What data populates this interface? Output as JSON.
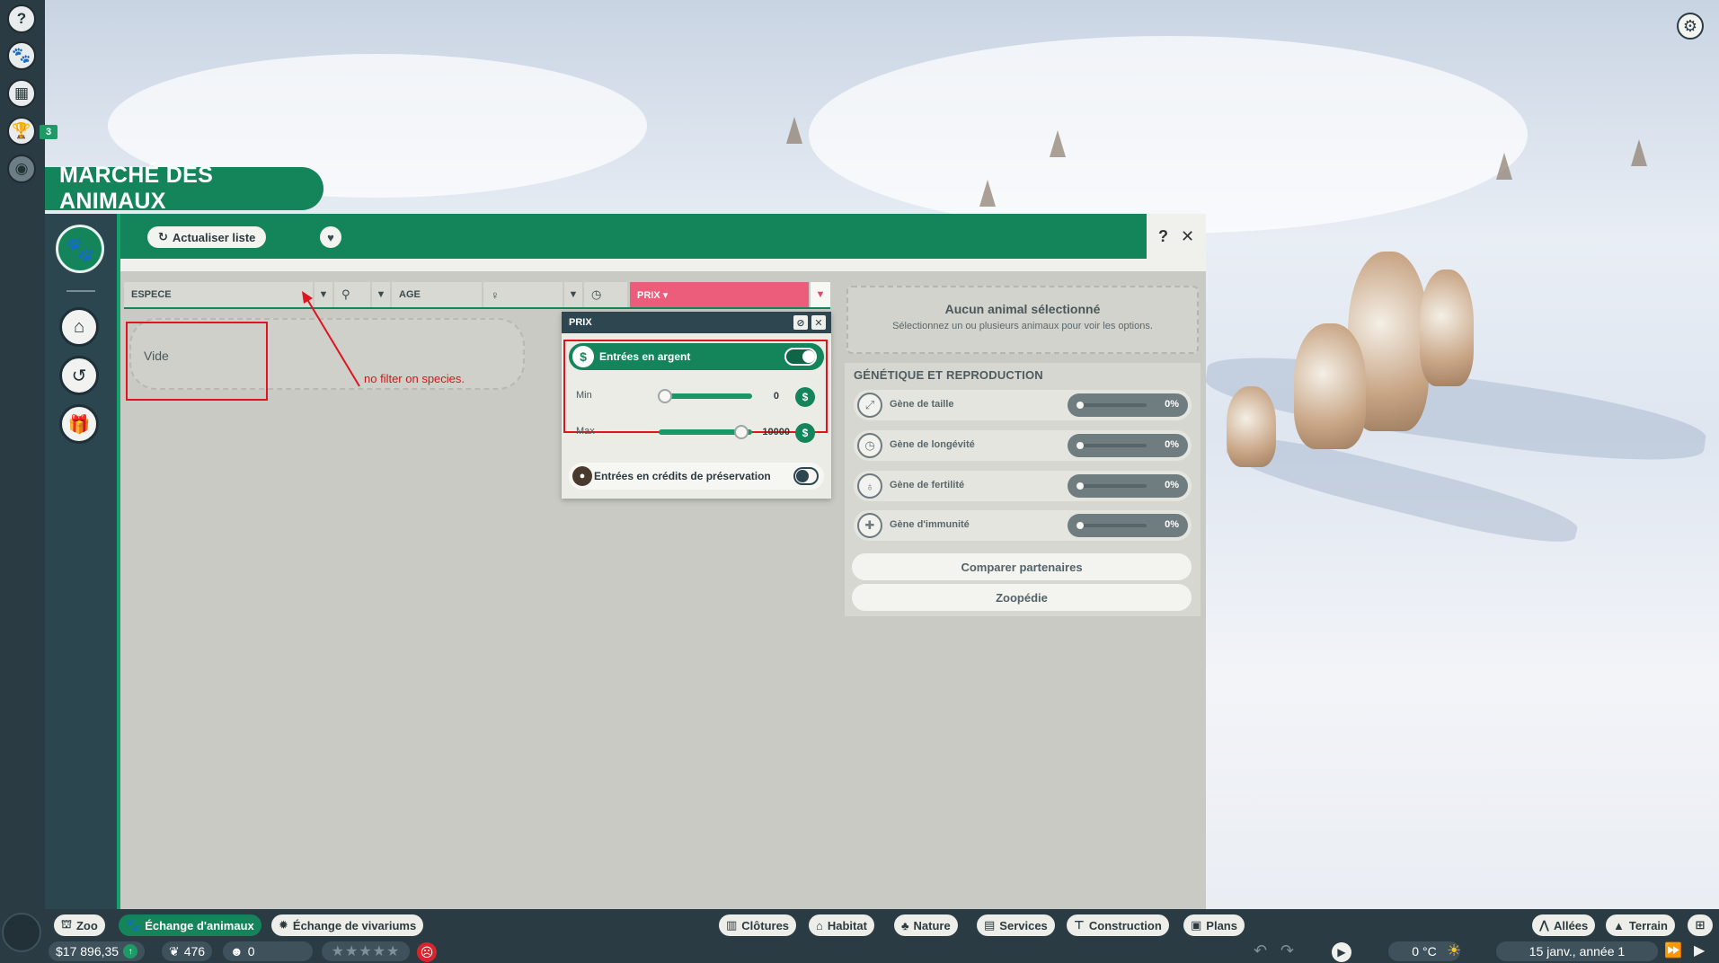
{
  "title": "MARCHÉ DES ANIMAUX",
  "left_rail": {
    "help_icon": "?",
    "badge_count": "3"
  },
  "toolbar": {
    "refresh_label": "Actualiser liste",
    "help_label": "?",
    "close_label": "✕"
  },
  "columns": {
    "espece": "ESPECE",
    "age": "AGE",
    "prix": "PRIX ▾"
  },
  "list": {
    "empty_label": "Vide"
  },
  "annotation": "no filter on species.",
  "prix_popup": {
    "title": "PRIX",
    "money_toggle_label": "Entrées en argent",
    "money_toggle_on": true,
    "min_label": "Min",
    "min_value": "0",
    "max_label": "Max",
    "max_value": "10000",
    "conservation_label": "Entrées en crédits de préservation",
    "conservation_on": false
  },
  "selection": {
    "title": "Aucun animal sélectionné",
    "subtitle": "Sélectionnez un ou plusieurs animaux pour voir les options."
  },
  "genetics": {
    "title": "GÉNÉTIQUE ET REPRODUCTION",
    "genes": [
      {
        "label": "Gène de taille",
        "value": "0%",
        "icon": "expand-icon"
      },
      {
        "label": "Gène de longévité",
        "value": "0%",
        "icon": "clock-icon"
      },
      {
        "label": "Gène de fertilité",
        "value": "0%",
        "icon": "drop-icon"
      },
      {
        "label": "Gène d'immunité",
        "value": "0%",
        "icon": "shield-icon"
      }
    ],
    "compare_label": "Comparer partenaires",
    "zoopedia_label": "Zoopédie"
  },
  "bottom_tabs": {
    "zoo": "Zoo",
    "animal_trade": "Échange d'animaux",
    "vivarium_trade": "Échange de vivariums",
    "fences": "Clôtures",
    "habitat": "Habitat",
    "nature": "Nature",
    "services": "Services",
    "construction": "Construction",
    "plans": "Plans",
    "paths": "Allées",
    "terrain": "Terrain"
  },
  "status": {
    "money": "$17 896,35",
    "conservation": "476",
    "guests": "0",
    "temperature": "0 °C",
    "date": "15 janv., année 1"
  },
  "colors": {
    "accent_green": "#14855b",
    "panel_dark": "#2c4650",
    "prix_pink": "#ec5d7b",
    "annotation_red": "#e0141e"
  }
}
